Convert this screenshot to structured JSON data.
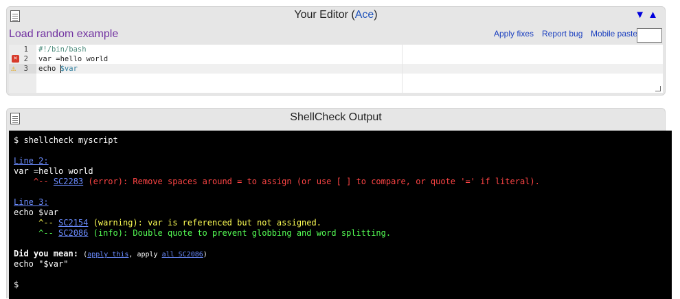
{
  "editor": {
    "title_prefix": "Your Editor (",
    "title_link": "Ace",
    "title_suffix": ")",
    "arrow_down": "▼",
    "arrow_up": "▲",
    "load_example": "Load random example",
    "apply_fixes": "Apply fixes",
    "report_bug": "Report bug",
    "mobile_paste": "Mobile paste:",
    "lines": [
      {
        "num": "1",
        "text": "#!/bin/bash",
        "marker": "none"
      },
      {
        "num": "2",
        "text": "var =hello world",
        "marker": "error"
      },
      {
        "num": "3",
        "text_before": "echo ",
        "text_after": "$var",
        "marker": "warning"
      }
    ]
  },
  "output": {
    "title": "ShellCheck Output",
    "prompt_cmd": "$ shellcheck myscript",
    "line2_link": "Line 2:",
    "line2_code": "var =hello world",
    "line2_caret": "^-- ",
    "line2_sc": "SC2283",
    "line2_msg": " (error): Remove spaces around = to assign (or use [ ] to compare, or quote '=' if literal).",
    "line3_link": "Line 3:",
    "line3_code": "echo $var",
    "warn_caret": "^-- ",
    "warn_sc": "SC2154",
    "warn_msg": " (warning): var is referenced but not assigned.",
    "info_caret": "^-- ",
    "info_sc": "SC2086",
    "info_msg": " (info): Double quote to prevent globbing and word splitting.",
    "did_you_mean": "Did you mean: ",
    "paren_open": "(",
    "apply_this": "apply this",
    "comma_apply": ", apply ",
    "apply_all": "all SC2086",
    "paren_close": ")",
    "suggestion": "echo \"$var\"",
    "final_prompt": "$"
  },
  "colors": {
    "error": "#ff4545",
    "warning": "#ffff55",
    "info": "#55ff55",
    "link": "#6b8cff",
    "load_example": "#7030a0"
  },
  "icons": [
    "document-icon",
    "error-icon",
    "warning-icon",
    "arrow-down-icon",
    "arrow-up-icon"
  ]
}
